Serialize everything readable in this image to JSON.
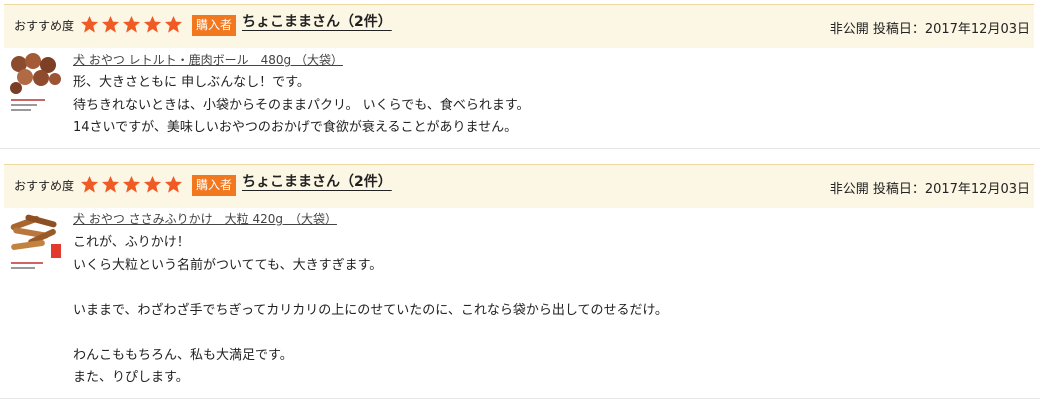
{
  "colors": {
    "header_bg": "#fcf6e4",
    "star": "#f05a24",
    "badge_bg": "#f27820"
  },
  "reviews": [
    {
      "rec_label": "おすすめ度",
      "rating": 5,
      "badge": "購入者",
      "reviewer": "ちょこままさん（2件）",
      "meta": "非公開 投稿日：2017年12月03日",
      "thumbnail_icon": "product-photo-meatballs",
      "product": "犬 おやつ レトルト・鹿肉ボール　480g （大袋）",
      "body": [
        "形、大きさともに 申しぶんなし！です。",
        "待ちきれないときは、小袋からそのままパクリ。 いくらでも、食べられます。",
        "14さいですが、美味しいおやつのおかげで食欲が衰えることがありません。"
      ]
    },
    {
      "rec_label": "おすすめ度",
      "rating": 5,
      "badge": "購入者",
      "reviewer": "ちょこままさん（2件）",
      "meta": "非公開 投稿日：2017年12月03日",
      "thumbnail_icon": "product-photo-chicken-sticks",
      "product": "犬 おやつ ささみふりかけ　大粒 420g　（大袋）",
      "body": [
        "これが、ふりかけ！",
        "いくら大粒という名前がついてても、大きすぎます。",
        "",
        "いままで、わざわざ手でちぎってカリカリの上にのせていたのに、これなら袋から出してのせるだけ。",
        "",
        "わんこももちろん、私も大満足です。",
        "また、りぴします。"
      ]
    }
  ]
}
